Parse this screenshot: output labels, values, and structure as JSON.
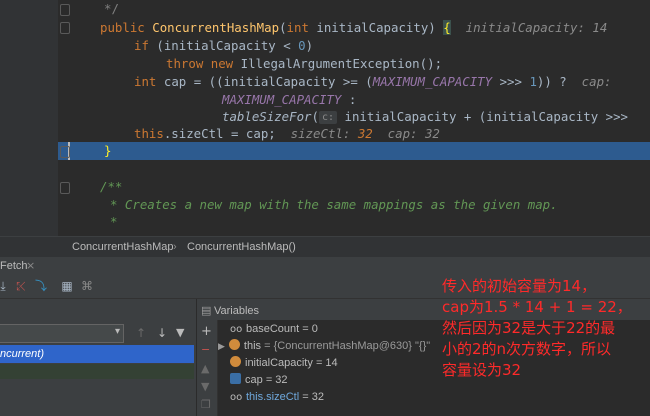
{
  "editor": {
    "lines": [
      {
        "text": "*/"
      },
      {
        "kw": "public",
        "name": "ConcurrentHashMap",
        "param_kw": "int",
        "param": "initialCapacity",
        "hint": "initialCapacity: 14"
      },
      {
        "kw": "if",
        "cond": "initialCapacity <",
        "num": "0"
      },
      {
        "kw": "throw new",
        "text": "IllegalArgumentException();"
      },
      {
        "kw": "int",
        "text": "cap = ((initialCapacity >=",
        "const": "MAXIMUM_CAPACITY",
        "ops": ">>>",
        "num": "1",
        "rest": ")) ?",
        "hint": "cap:"
      },
      {
        "const": "MAXIMUM_CAPACITY",
        "rest": ":"
      },
      {
        "method": "tableSizeFor",
        "param_hint": "c:",
        "rest": "initialCapacity + (initialCapacity >>>"
      },
      {
        "kw": "this",
        "text": ".sizeCtl = cap;",
        "hint1": "sizeCtl:",
        "hint1_val": "32",
        "hint2": "cap: 32"
      },
      {
        "text": "}"
      },
      {
        "text": ""
      },
      {
        "text": "/**"
      },
      {
        "text": "* Creates a new map with the same mappings as the given map."
      },
      {
        "text": "*"
      }
    ]
  },
  "breadcrumb": {
    "items": [
      "ConcurrentHashMap",
      "ConcurrentHashMap()"
    ]
  },
  "debug": {
    "tab_label": "Fetch",
    "frames_selected": "ncurrent)",
    "vars_title": "Variables",
    "variables": [
      {
        "name": "baseCount",
        "value": "= 0"
      },
      {
        "name": "this",
        "value": "= {ConcurrentHashMap@630} \"{}\""
      },
      {
        "name": "initialCapacity",
        "value": "= 14"
      },
      {
        "name": "cap",
        "value": "= 32"
      },
      {
        "name": "this.sizeCtl",
        "value": "= 32"
      }
    ]
  },
  "annotation": {
    "lines": [
      "传入的初始容量为14，",
      "cap为1.5 * 14 + 1 = 22，",
      "然后因为32是大于22的最",
      "小的2的n次方数字，所以",
      "容量设为32"
    ]
  },
  "colors": {
    "accent_selection": "#2f65ca",
    "current_line": "#2d5b8f",
    "annotation": "#ff2a2a"
  }
}
